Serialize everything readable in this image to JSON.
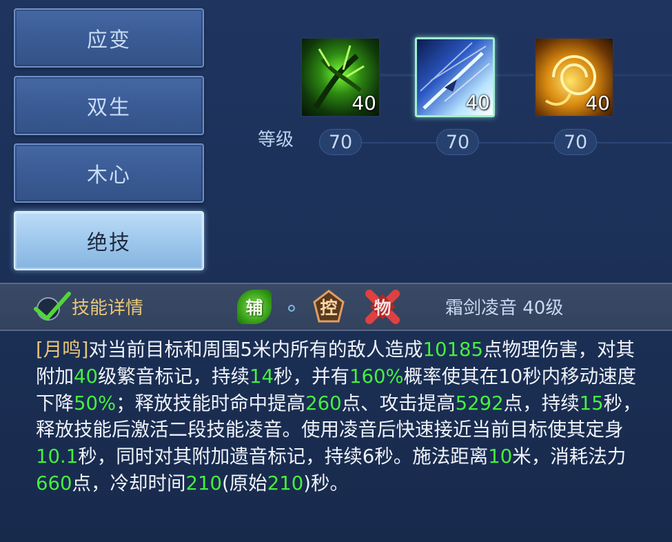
{
  "tabs": [
    {
      "label": "应变",
      "active": false
    },
    {
      "label": "双生",
      "active": false
    },
    {
      "label": "木心",
      "active": false
    },
    {
      "label": "绝技",
      "active": true
    }
  ],
  "skills": [
    {
      "icon": "green-thorn-skill-icon",
      "level": "40",
      "req": "70",
      "selected": false
    },
    {
      "icon": "ice-arrow-skill-icon",
      "level": "40",
      "req": "70",
      "selected": true
    },
    {
      "icon": "golden-vortex-skill-icon",
      "level": "40",
      "req": "70",
      "selected": false
    }
  ],
  "level_label": "等级",
  "detail": {
    "title": "技能详情",
    "badges": [
      "辅",
      "控",
      "物"
    ],
    "skill_name": "霜剑凌音 40级",
    "desc": {
      "tag": "[月鸣]",
      "p1": "对当前目标和周围5米内所有的敌人造成",
      "v1": "10185",
      "p2": "点物理伤害，对其附加",
      "v2": "40",
      "p3": "级繁音标记，持续",
      "v3": "14",
      "p4": "秒，并有",
      "v4": "160%",
      "p5": "概率使其在10秒内移动速度下降",
      "v5": "50%",
      "p6": "；释放技能时命中提高",
      "v6": "260",
      "p7": "点、攻击提高",
      "v7": "5292",
      "p8": "点，持续",
      "v8": "15",
      "p9": "秒，释放技能后激活二段技能凌音。使用凌音后快速接近当前目标使其定身",
      "v9": "10.1",
      "p10": "秒，同时对其附加遗音标记，持续6秒。施法距离",
      "v10": "10",
      "p11": "米，消耗法力",
      "v11": "660",
      "p12": "点，冷却时间",
      "v12": "210",
      "p13": "(原始",
      "v13": "210",
      "p14": ")秒。"
    }
  },
  "colors": {
    "highlight": "#45f040",
    "gold": "#e9c77a",
    "active_tab": "#bcdcf6"
  }
}
